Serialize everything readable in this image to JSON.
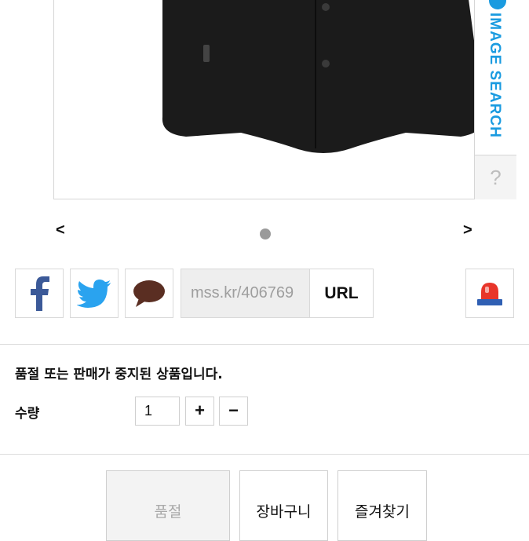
{
  "image_search": {
    "label": "IMAGE SEARCH",
    "help": "?"
  },
  "carousel": {
    "prev": "<",
    "next": ">"
  },
  "share": {
    "facebook_icon": "facebook-icon",
    "twitter_icon": "twitter-icon",
    "kakaostory_icon": "speech-bubble-icon",
    "report_icon": "alarm-siren-icon",
    "short_url": "mss.kr/406769",
    "url_button": "URL"
  },
  "product": {
    "status_notice": "품절 또는 판매가 중지된 상품입니다.",
    "quantity_label": "수량",
    "quantity_value": "1",
    "plus": "+",
    "minus": "−"
  },
  "actions": {
    "soldout": "품절",
    "cart": "장바구니",
    "favorite": "즐겨찾기"
  },
  "colors": {
    "accent_blue": "#1a9be0",
    "facebook_blue": "#3b5998",
    "twitter_blue": "#2aa3ef",
    "kakao_brown": "#5a2e22",
    "siren_red": "#e8352a"
  }
}
